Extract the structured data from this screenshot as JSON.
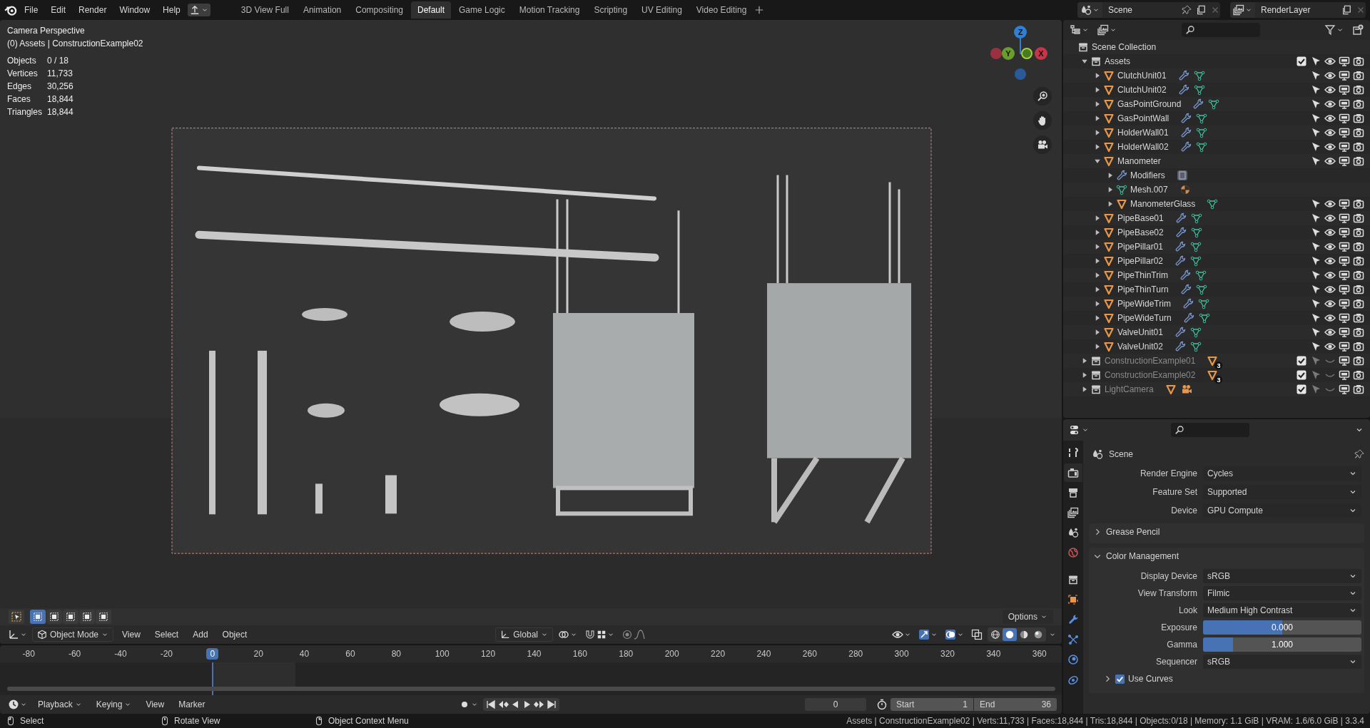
{
  "topbar": {
    "menus": [
      "File",
      "Edit",
      "Render",
      "Window",
      "Help"
    ],
    "workspaces": [
      {
        "label": "3D View Full",
        "selected": false
      },
      {
        "label": "Animation",
        "selected": false
      },
      {
        "label": "Compositing",
        "selected": false
      },
      {
        "label": "Default",
        "selected": true
      },
      {
        "label": "Game Logic",
        "selected": false
      },
      {
        "label": "Motion Tracking",
        "selected": false
      },
      {
        "label": "Scripting",
        "selected": false
      },
      {
        "label": "UV Editing",
        "selected": false
      },
      {
        "label": "Video Editing",
        "selected": false
      }
    ]
  },
  "scene_selector": {
    "scene": "Scene",
    "view_layer": "RenderLayer"
  },
  "viewport": {
    "view_name": "Camera Perspective",
    "collection": "(0) Assets | ConstructionExample02",
    "stats": [
      {
        "label": "Objects",
        "value": "0 / 18"
      },
      {
        "label": "Vertices",
        "value": "11,733"
      },
      {
        "label": "Edges",
        "value": "30,256"
      },
      {
        "label": "Faces",
        "value": "18,844"
      },
      {
        "label": "Triangles",
        "value": "18,844"
      }
    ],
    "gizmo_axes": [
      {
        "label": "Z",
        "color": "#2f7fd6"
      },
      {
        "label": "Y",
        "color": "#6a9e2a"
      },
      {
        "label": "X",
        "color": "#c8344a"
      }
    ],
    "select_modes": [
      {
        "selected": true
      },
      {
        "selected": false
      },
      {
        "selected": false
      },
      {
        "selected": false
      },
      {
        "selected": false
      }
    ],
    "options": "Options",
    "mode": "Object Mode",
    "menus": [
      "View",
      "Select",
      "Add",
      "Object"
    ],
    "orientation": "Global",
    "shading": [
      {
        "kind": "wireframe",
        "selected": false
      },
      {
        "kind": "solid",
        "selected": true
      },
      {
        "kind": "material",
        "selected": false
      },
      {
        "kind": "rendered",
        "selected": false
      }
    ]
  },
  "timeline": {
    "ticks": [
      {
        "label": "-80",
        "selected": false
      },
      {
        "label": "-60",
        "selected": false
      },
      {
        "label": "-40",
        "selected": false
      },
      {
        "label": "-20",
        "selected": false
      },
      {
        "label": "0",
        "selected": true
      },
      {
        "label": "20",
        "selected": false
      },
      {
        "label": "40",
        "selected": false
      },
      {
        "label": "60",
        "selected": false
      },
      {
        "label": "80",
        "selected": false
      },
      {
        "label": "100",
        "selected": false
      },
      {
        "label": "120",
        "selected": false
      },
      {
        "label": "140",
        "selected": false
      },
      {
        "label": "160",
        "selected": false
      },
      {
        "label": "180",
        "selected": false
      },
      {
        "label": "200",
        "selected": false
      },
      {
        "label": "220",
        "selected": false
      },
      {
        "label": "240",
        "selected": false
      },
      {
        "label": "260",
        "selected": false
      },
      {
        "label": "280",
        "selected": false
      },
      {
        "label": "300",
        "selected": false
      },
      {
        "label": "320",
        "selected": false
      },
      {
        "label": "340",
        "selected": false
      },
      {
        "label": "360",
        "selected": false
      }
    ],
    "menus": [
      {
        "label": "Playback",
        "dropdown": true
      },
      {
        "label": "Keying",
        "dropdown": true
      },
      {
        "label": "View",
        "dropdown": false
      },
      {
        "label": "Marker",
        "dropdown": false
      }
    ],
    "current_frame": "0",
    "start_label": "Start",
    "start": "1",
    "end_label": "End",
    "end": "36"
  },
  "outliner": {
    "items": [
      {
        "kind": "scene_collection",
        "name": "Scene Collection",
        "children": [
          {
            "kind": "collection",
            "name": "Assets",
            "expanded": true,
            "checked": true,
            "hidden": false,
            "children": [
              {
                "kind": "object",
                "name": "ClutchUnit01",
                "expanded": false,
                "hidden": false,
                "sub_items": [
                  {
                    "kind": "modifier"
                  },
                  {
                    "kind": "mesh"
                  }
                ]
              },
              {
                "kind": "object",
                "name": "ClutchUnit02",
                "expanded": false,
                "hidden": false,
                "sub_items": [
                  {
                    "kind": "modifier"
                  },
                  {
                    "kind": "mesh"
                  }
                ]
              },
              {
                "kind": "object",
                "name": "GasPointGround",
                "expanded": false,
                "hidden": false,
                "sub_items": [
                  {
                    "kind": "modifier"
                  },
                  {
                    "kind": "mesh"
                  }
                ]
              },
              {
                "kind": "object",
                "name": "GasPointWall",
                "expanded": false,
                "hidden": false,
                "sub_items": [
                  {
                    "kind": "modifier"
                  },
                  {
                    "kind": "mesh"
                  }
                ]
              },
              {
                "kind": "object",
                "name": "HolderWall01",
                "expanded": false,
                "hidden": false,
                "sub_items": [
                  {
                    "kind": "modifier"
                  },
                  {
                    "kind": "mesh"
                  }
                ]
              },
              {
                "kind": "object",
                "name": "HolderWall02",
                "expanded": false,
                "hidden": false,
                "sub_items": [
                  {
                    "kind": "modifier"
                  },
                  {
                    "kind": "mesh"
                  }
                ]
              },
              {
                "kind": "object",
                "name": "Manometer",
                "expanded": true,
                "hidden": false,
                "children": [
                  {
                    "kind": "modifiers",
                    "name": "Modifiers",
                    "expanded": false,
                    "sub_items": [
                      {
                        "kind": "modifier_toggle"
                      }
                    ]
                  },
                  {
                    "kind": "mesh",
                    "name": "Mesh.007",
                    "expanded": false,
                    "sub_items": [
                      {
                        "kind": "material"
                      }
                    ]
                  },
                  {
                    "kind": "object",
                    "name": "ManometerGlass",
                    "expanded": false,
                    "hidden": false,
                    "sub_items": [
                      {
                        "kind": "mesh"
                      }
                    ]
                  }
                ]
              },
              {
                "kind": "object",
                "name": "PipeBase01",
                "expanded": false,
                "hidden": false,
                "sub_items": [
                  {
                    "kind": "modifier"
                  },
                  {
                    "kind": "mesh"
                  }
                ]
              },
              {
                "kind": "object",
                "name": "PipeBase02",
                "expanded": false,
                "hidden": false,
                "sub_items": [
                  {
                    "kind": "modifier"
                  },
                  {
                    "kind": "mesh"
                  }
                ]
              },
              {
                "kind": "object",
                "name": "PipePillar01",
                "expanded": false,
                "hidden": false,
                "sub_items": [
                  {
                    "kind": "modifier"
                  },
                  {
                    "kind": "mesh"
                  }
                ]
              },
              {
                "kind": "object",
                "name": "PipePillar02",
                "expanded": false,
                "hidden": false,
                "sub_items": [
                  {
                    "kind": "modifier"
                  },
                  {
                    "kind": "mesh"
                  }
                ]
              },
              {
                "kind": "object",
                "name": "PipeThinTrim",
                "expanded": false,
                "hidden": false,
                "sub_items": [
                  {
                    "kind": "modifier"
                  },
                  {
                    "kind": "mesh"
                  }
                ]
              },
              {
                "kind": "object",
                "name": "PipeThinTurn",
                "expanded": false,
                "hidden": false,
                "sub_items": [
                  {
                    "kind": "modifier"
                  },
                  {
                    "kind": "mesh"
                  }
                ]
              },
              {
                "kind": "object",
                "name": "PipeWideTrim",
                "expanded": false,
                "hidden": false,
                "sub_items": [
                  {
                    "kind": "modifier"
                  },
                  {
                    "kind": "mesh"
                  }
                ]
              },
              {
                "kind": "object",
                "name": "PipeWideTurn",
                "expanded": false,
                "hidden": false,
                "sub_items": [
                  {
                    "kind": "modifier"
                  },
                  {
                    "kind": "mesh"
                  }
                ]
              },
              {
                "kind": "object",
                "name": "ValveUnit01",
                "expanded": false,
                "hidden": false,
                "sub_items": [
                  {
                    "kind": "modifier"
                  },
                  {
                    "kind": "mesh"
                  }
                ]
              },
              {
                "kind": "object",
                "name": "ValveUnit02",
                "expanded": false,
                "hidden": false,
                "sub_items": [
                  {
                    "kind": "modifier"
                  },
                  {
                    "kind": "mesh"
                  }
                ]
              }
            ]
          },
          {
            "kind": "collection",
            "name": "ConstructionExample01",
            "expanded": false,
            "checked": true,
            "hidden": true,
            "sub_items": [
              {
                "kind": "object"
              }
            ],
            "badge": "3"
          },
          {
            "kind": "collection",
            "name": "ConstructionExample02",
            "expanded": false,
            "checked": true,
            "hidden": true,
            "sub_items": [
              {
                "kind": "object"
              }
            ],
            "badge": "3"
          },
          {
            "kind": "collection",
            "name": "LightCamera",
            "expanded": false,
            "checked": true,
            "hidden": true,
            "sub_items": [
              {
                "kind": "object"
              },
              {
                "kind": "camera"
              }
            ]
          }
        ]
      }
    ]
  },
  "properties": {
    "tabs": [
      {
        "kind": "tool",
        "selected": false
      },
      {
        "kind": "render",
        "selected": true
      },
      {
        "kind": "output",
        "selected": false
      },
      {
        "kind": "view_layer",
        "selected": false
      },
      {
        "kind": "scene",
        "selected": false
      },
      {
        "kind": "world",
        "selected": false
      },
      {
        "kind": "collection",
        "selected": false
      },
      {
        "kind": "object",
        "selected": false
      },
      {
        "kind": "modifiers",
        "selected": false
      },
      {
        "kind": "particles",
        "selected": false
      },
      {
        "kind": "physics",
        "selected": false
      },
      {
        "kind": "constraints",
        "selected": false
      }
    ],
    "context": "Scene",
    "rows": [
      {
        "kind": "dropdown",
        "label": "Render Engine",
        "value": "Cycles"
      },
      {
        "kind": "dropdown",
        "label": "Feature Set",
        "value": "Supported"
      },
      {
        "kind": "dropdown",
        "label": "Device",
        "value": "GPU Compute"
      },
      {
        "kind": "panel",
        "title": "Grease Pencil",
        "expanded": false
      },
      {
        "kind": "panel",
        "title": "Color Management",
        "expanded": true,
        "rows": [
          {
            "kind": "dropdown",
            "label": "Display Device",
            "value": "sRGB"
          },
          {
            "kind": "dropdown",
            "label": "View Transform",
            "value": "Filmic"
          },
          {
            "kind": "dropdown",
            "label": "Look",
            "value": "Medium High Contrast"
          },
          {
            "kind": "slider",
            "label": "Exposure",
            "value": "0.000",
            "level": 0.5
          },
          {
            "kind": "slider",
            "label": "Gamma",
            "value": "1.000",
            "level": 0.19
          },
          {
            "kind": "dropdown",
            "label": "Sequencer",
            "value": "sRGB"
          },
          {
            "kind": "subpanel",
            "title": "Use Curves",
            "expanded": false,
            "checked": true
          }
        ]
      }
    ]
  },
  "status_bar": {
    "hints": [
      "Select",
      "Rotate View",
      "Object Context Menu"
    ],
    "info": "Assets | ConstructionExample02 | Verts:11,733 | Faces:18,844 | Tris:18,844 | Objects:0/18 | Memory: 1.1 GiB | VRAM: 1.6/6.0 GiB | 3.3.4"
  }
}
